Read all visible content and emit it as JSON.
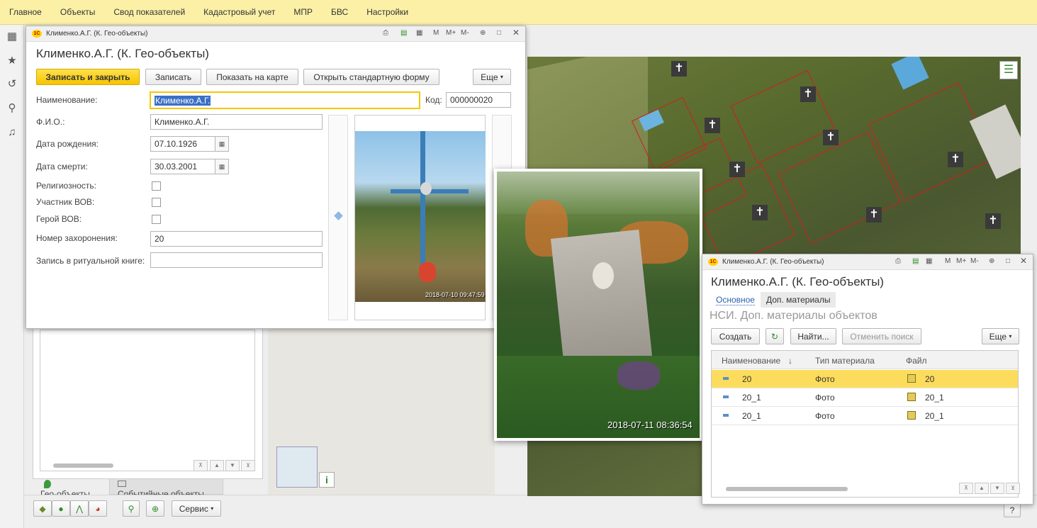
{
  "top_menu": {
    "items": [
      "Главное",
      "Объекты",
      "Свод показателей",
      "Кадастровый учет",
      "МПР",
      "БВС",
      "Настройки"
    ]
  },
  "main_form": {
    "window_title": "Клименко.А.Г. (К. Гео-объекты)",
    "form_title": "Клименко.А.Г. (К. Гео-объекты)",
    "buttons": {
      "save_close": "Записать и закрыть",
      "save": "Записать",
      "show_on_map": "Показать на карте",
      "open_standard": "Открыть стандартную форму",
      "more": "Еще"
    },
    "fields": {
      "name_label": "Наименование:",
      "name_value": "Клименко.А.Г.",
      "code_label": "Код:",
      "code_value": "000000020",
      "fio_label": "Ф.И.О.:",
      "fio_value": "Клименко.А.Г.",
      "birth_label": "Дата рождения:",
      "birth_value": "07.10.1926",
      "death_label": "Дата смерти:",
      "death_value": "30.03.2001",
      "religion_label": "Религиозность:",
      "wwii_participant_label": "Участник ВОВ:",
      "wwii_hero_label": "Герой ВОВ:",
      "burial_number_label": "Номер захоронения:",
      "burial_number_value": "20",
      "ritual_book_label": "Запись в ритуальной книге:",
      "ritual_book_value": ""
    },
    "photo_timestamp": "2018-07-10 09:47:59"
  },
  "large_photo": {
    "timestamp": "2018-07-11 08:36:54"
  },
  "materials_form": {
    "window_title": "Клименко.А.Г. (К. Гео-объекты)",
    "form_title": "Клименко.А.Г. (К. Гео-объекты)",
    "tabs": [
      "Основное",
      "Доп. материалы"
    ],
    "subtitle": "НСИ. Доп. материалы объектов",
    "buttons": {
      "create": "Создать",
      "find": "Найти...",
      "cancel_search": "Отменить поиск",
      "more": "Еще"
    },
    "columns": [
      "Наименование",
      "Тип материала",
      "Файл"
    ],
    "sort_indicator": "↓",
    "rows": [
      {
        "name": "20",
        "type": "Фото",
        "file": "20"
      },
      {
        "name": "20_1",
        "type": "Фото",
        "file": "20_1"
      },
      {
        "name": "20_1",
        "type": "Фото",
        "file": "20_1"
      }
    ]
  },
  "bottom": {
    "tab_geo": "Гео-объекты",
    "tab_events": "Событийные объекты",
    "service_button": "Сервис",
    "info_icon": "i",
    "help": "?"
  }
}
